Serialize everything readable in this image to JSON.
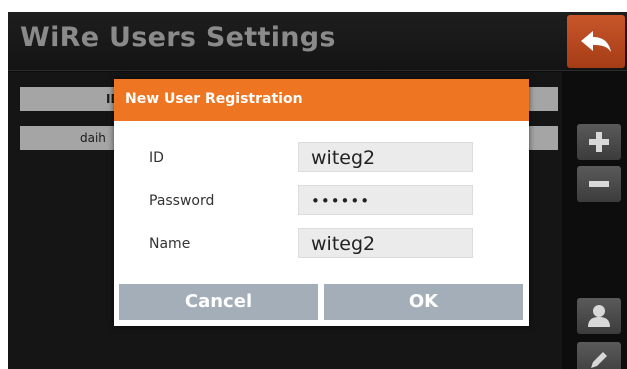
{
  "header": {
    "title": "WiRe Users Settings",
    "back_icon": "back-arrow-icon"
  },
  "table": {
    "column_header": "ID",
    "rows": [
      "daih"
    ]
  },
  "side_buttons": {
    "add_icon": "plus-icon",
    "remove_icon": "minus-icon",
    "user_icon": "user-icon",
    "edit_icon": "pencil-icon"
  },
  "dialog": {
    "title": "New User Registration",
    "fields": [
      {
        "label": "ID",
        "value": "witeg2"
      },
      {
        "label": "Password",
        "value": "••••••"
      },
      {
        "label": "Name",
        "value": "witeg2"
      }
    ],
    "cancel_label": "Cancel",
    "ok_label": "OK"
  },
  "colors": {
    "accent": "#ee7521",
    "back_button": "#b5471d",
    "dialog_button": "#a3aeb8"
  }
}
